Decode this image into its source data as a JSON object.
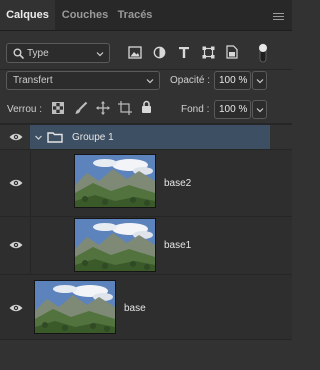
{
  "tabs": [
    {
      "label": "Calques",
      "active": true
    },
    {
      "label": "Couches",
      "active": false
    },
    {
      "label": "Tracés",
      "active": false
    }
  ],
  "filter": {
    "type_label": "Type",
    "icons": [
      "image-filter-icon",
      "adjustment-filter-icon",
      "text-filter-icon",
      "shape-filter-icon",
      "smart-object-filter-icon"
    ]
  },
  "blend": {
    "mode": "Transfert",
    "opacity_label": "Opacité :",
    "opacity_value": "100 %"
  },
  "lock": {
    "label": "Verrou :",
    "fill_label": "Fond :",
    "fill_value": "100 %"
  },
  "layers": [
    {
      "name": "Groupe 1",
      "type": "group",
      "selected": true
    },
    {
      "name": "base2",
      "type": "image",
      "indent": true
    },
    {
      "name": "base1",
      "type": "image",
      "indent": true
    },
    {
      "name": "base",
      "type": "image",
      "indent": false
    }
  ],
  "colors": {
    "accent_selected": "#3c4f63",
    "panel": "#323232",
    "row": "#2e2e2e"
  }
}
